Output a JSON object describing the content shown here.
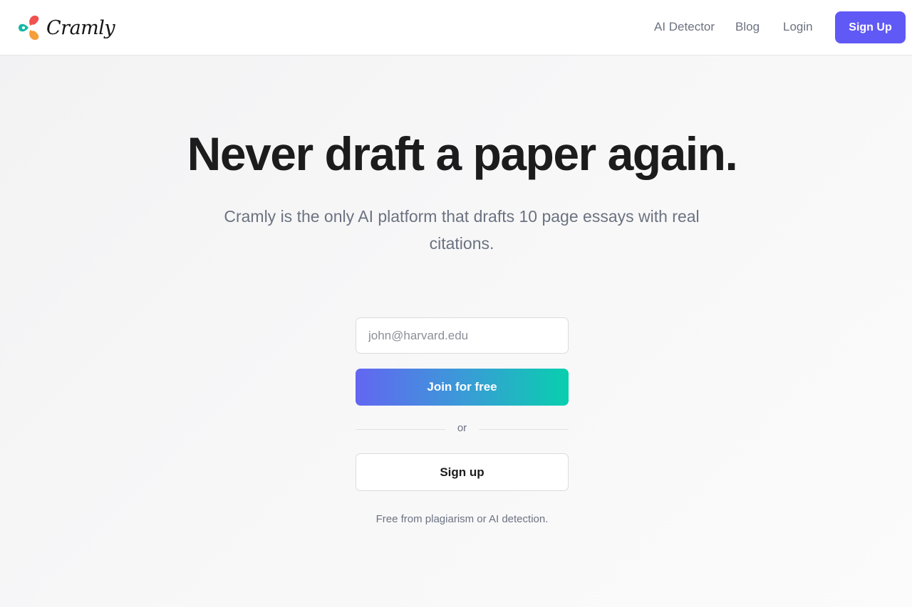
{
  "header": {
    "logo_text": "Cramly",
    "logo_icon": "cramly-logo-icon",
    "nav": {
      "ai_detector": "AI Detector",
      "blog": "Blog",
      "login": "Login"
    },
    "signup_label": "Sign Up"
  },
  "hero": {
    "title": "Never draft a paper again.",
    "subtitle": "Cramly is the only AI platform that drafts 10 page essays with real citations."
  },
  "form": {
    "email_placeholder": "john@harvard.edu",
    "email_value": "",
    "join_label": "Join for free",
    "divider_text": "or",
    "signup_label": "Sign up",
    "footnote": "Free from plagiarism or AI detection."
  },
  "colors": {
    "accent": "#6159f5",
    "gradient_start": "#6366f1",
    "gradient_end": "#08cfae",
    "logo_teal": "#14b8a6",
    "logo_red": "#f0524f",
    "logo_orange": "#f59e3a"
  }
}
